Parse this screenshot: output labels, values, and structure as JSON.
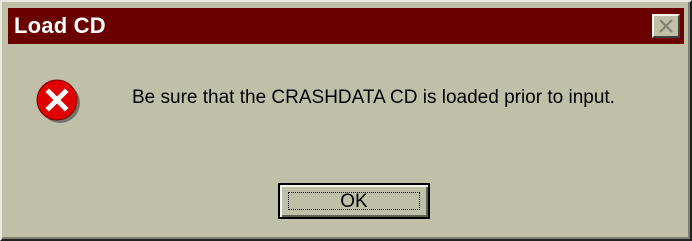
{
  "window": {
    "title": "Load CD",
    "close_icon": "close-icon",
    "titlebar_color": "#6b0000",
    "body_color": "#c0c0a8"
  },
  "message": {
    "icon": "error-icon",
    "icon_color": "#e00000",
    "text": "Be sure that the CRASHDATA CD is loaded prior to input."
  },
  "buttons": {
    "ok_label": "OK"
  }
}
